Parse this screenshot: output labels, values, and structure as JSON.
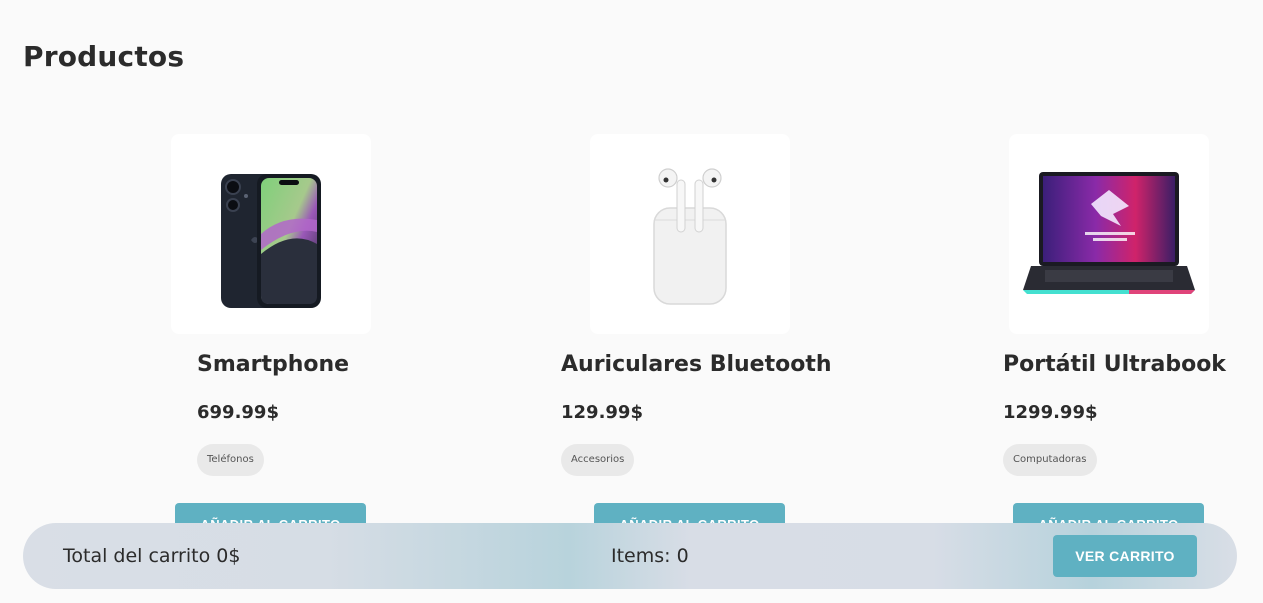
{
  "page": {
    "title": "Productos"
  },
  "products": [
    {
      "name": "Smartphone",
      "price": "699.99$",
      "category": "Teléfonos",
      "button_label": "AÑADIR AL CARRITO",
      "icon": "smartphone-image"
    },
    {
      "name": "Auriculares Bluetooth",
      "price": "129.99$",
      "category": "Accesorios",
      "button_label": "AÑADIR AL CARRITO",
      "icon": "earbuds-image"
    },
    {
      "name": "Portátil Ultrabook",
      "price": "1299.99$",
      "category": "Computadoras",
      "button_label": "AÑADIR AL CARRITO",
      "icon": "laptop-image"
    }
  ],
  "cart": {
    "total_label": "Total del carrito 0$",
    "items_label": "Items: 0",
    "view_button": "VER CARRITO"
  },
  "colors": {
    "accent": "#5fb1c2",
    "background": "#fafafa",
    "text": "#2b2b2b"
  }
}
